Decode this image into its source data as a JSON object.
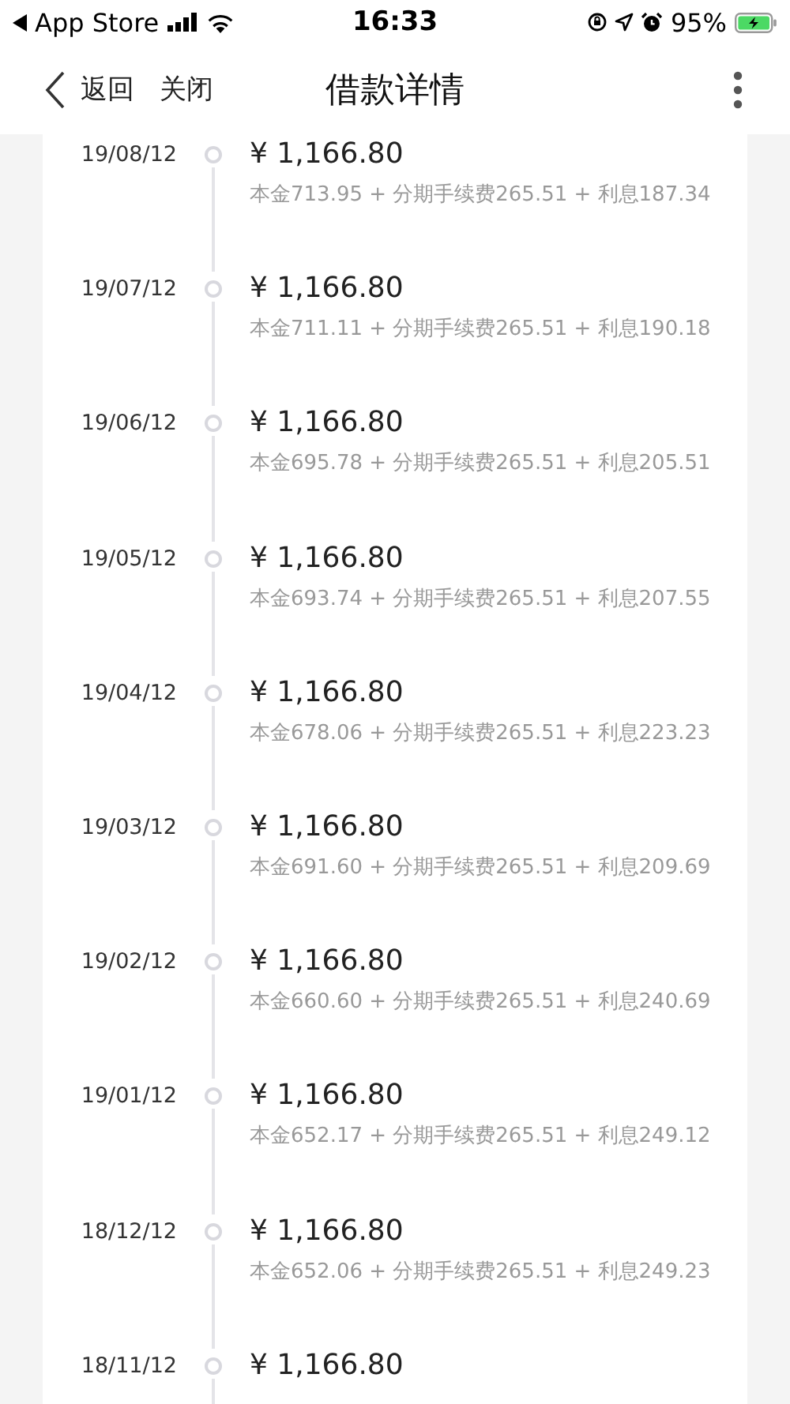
{
  "status_bar": {
    "back_app": "App Store",
    "time": "16:33",
    "battery": "95%"
  },
  "nav": {
    "back": "返回",
    "close": "关闭",
    "title": "借款详情"
  },
  "installments": [
    {
      "date": "19/08/12",
      "amount": "¥ 1,166.80",
      "detail": "本金713.95 + 分期手续费265.51 + 利息187.34"
    },
    {
      "date": "19/07/12",
      "amount": "¥ 1,166.80",
      "detail": "本金711.11 + 分期手续费265.51 + 利息190.18"
    },
    {
      "date": "19/06/12",
      "amount": "¥ 1,166.80",
      "detail": "本金695.78 + 分期手续费265.51 + 利息205.51"
    },
    {
      "date": "19/05/12",
      "amount": "¥ 1,166.80",
      "detail": "本金693.74 + 分期手续费265.51 + 利息207.55"
    },
    {
      "date": "19/04/12",
      "amount": "¥ 1,166.80",
      "detail": "本金678.06 + 分期手续费265.51 + 利息223.23"
    },
    {
      "date": "19/03/12",
      "amount": "¥ 1,166.80",
      "detail": "本金691.60 + 分期手续费265.51 + 利息209.69"
    },
    {
      "date": "19/02/12",
      "amount": "¥ 1,166.80",
      "detail": "本金660.60 + 分期手续费265.51 + 利息240.69"
    },
    {
      "date": "19/01/12",
      "amount": "¥ 1,166.80",
      "detail": "本金652.17 + 分期手续费265.51 + 利息249.12"
    },
    {
      "date": "18/12/12",
      "amount": "¥ 1,166.80",
      "detail": "本金652.06 + 分期手续费265.51 + 利息249.23"
    },
    {
      "date": "18/11/12",
      "amount": "¥ 1,166.80"
    }
  ]
}
